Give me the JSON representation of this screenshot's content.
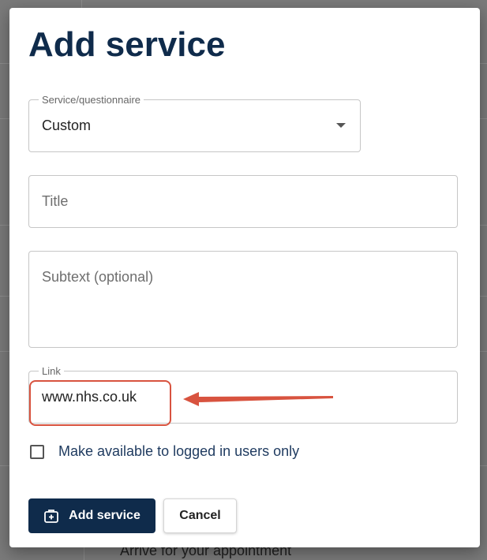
{
  "background": {
    "peek_text": "Arrive for your appointment"
  },
  "dialog": {
    "title": "Add service",
    "service_select": {
      "label": "Service/questionnaire",
      "value": "Custom"
    },
    "title_field": {
      "placeholder": "Title"
    },
    "subtext_field": {
      "placeholder": "Subtext (optional)"
    },
    "link_field": {
      "label": "Link",
      "value": "www.nhs.co.uk"
    },
    "checkbox": {
      "label": "Make available to logged in users only",
      "checked": false
    },
    "buttons": {
      "primary": "Add service",
      "secondary": "Cancel"
    }
  },
  "annotation": {
    "highlight_color": "#d8533f"
  },
  "colors": {
    "brand": "#0f2b4b"
  }
}
